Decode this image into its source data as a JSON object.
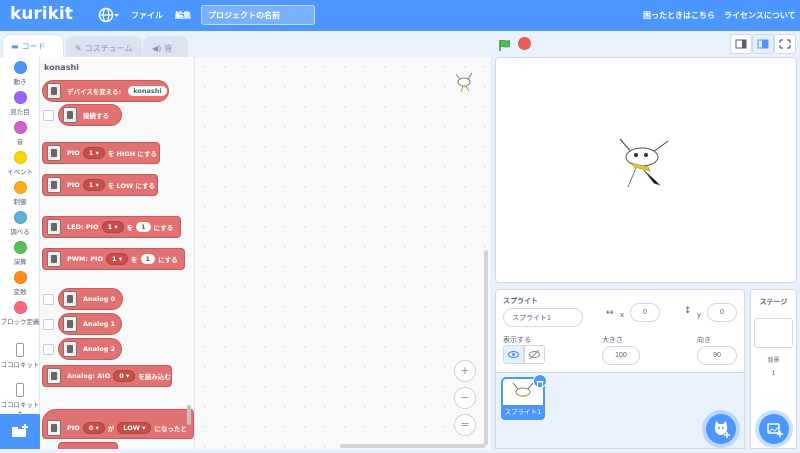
{
  "menubar": {
    "logo": "kurikit",
    "file": "ファイル",
    "edit": "編集",
    "project_title": "プロジェクトの名前",
    "help": "困ったときはこちら",
    "license": "ライセンスについて"
  },
  "tabs": {
    "code": "コード",
    "costume": "コスチューム",
    "sound": "音"
  },
  "categories": [
    {
      "label": "動き",
      "color": "#4c97ff"
    },
    {
      "label": "見た目",
      "color": "#9966ff"
    },
    {
      "label": "音",
      "color": "#cf63cf"
    },
    {
      "label": "イベント",
      "color": "#ffd500"
    },
    {
      "label": "制御",
      "color": "#ffab19"
    },
    {
      "label": "調べる",
      "color": "#5cb1d6"
    },
    {
      "label": "演算",
      "color": "#59c059"
    },
    {
      "label": "変数",
      "color": "#ff8c1a"
    },
    {
      "label": "ブロック定義",
      "color": "#ff6680"
    },
    {
      "label": "ココロキット",
      "color": "#ffffff"
    },
    {
      "label": "ココロキット+",
      "color": "#ffffff"
    }
  ],
  "palette": {
    "title": "konashi",
    "change_device": {
      "text": "デバイスを変える:",
      "value": "konashi"
    },
    "connect": "接続する",
    "pio_high": {
      "prefix": "PIO",
      "pin": "1",
      "mid": "を HIGH にする"
    },
    "pio_low": {
      "prefix": "PIO",
      "pin": "1",
      "mid": "を LOW にする"
    },
    "led": {
      "prefix": "LED: PIO",
      "pin": "1",
      "mid": "を",
      "val": "1",
      "suffix": "にする"
    },
    "pwm": {
      "prefix": "PWM: PIO",
      "pin": "1",
      "mid": "を",
      "val": "1",
      "suffix": "にする"
    },
    "analog0": "Analog 0",
    "analog1": "Analog 1",
    "analog2": "Analog 2",
    "analog_read": {
      "prefix": "Analog: AIO",
      "pin": "0",
      "suffix": "を読み込む"
    },
    "pio_when": {
      "prefix": "PIO",
      "pin": "0",
      "mid": "が",
      "val": "LOW",
      "suffix": "になったと"
    }
  },
  "zoom": {
    "in": "+",
    "out": "−",
    "reset": "="
  },
  "sprite_info": {
    "sprite_label": "スプライト",
    "sprite_name": "スプライト1",
    "x_label": "x",
    "x_value": "0",
    "y_label": "y",
    "y_value": "0",
    "show_label": "表示する",
    "size_label": "大きさ",
    "size_value": "100",
    "direction_label": "向き",
    "direction_value": "90"
  },
  "sprite_list": {
    "thumb_label": "スプライト1"
  },
  "stage_panel": {
    "title": "ステージ",
    "backdrops_label": "背景",
    "backdrops_count": "1"
  },
  "colors": {
    "accent": "#4c97ff",
    "block": "#e07272",
    "stop": "#ec5959",
    "flag": "#4cbf56"
  }
}
